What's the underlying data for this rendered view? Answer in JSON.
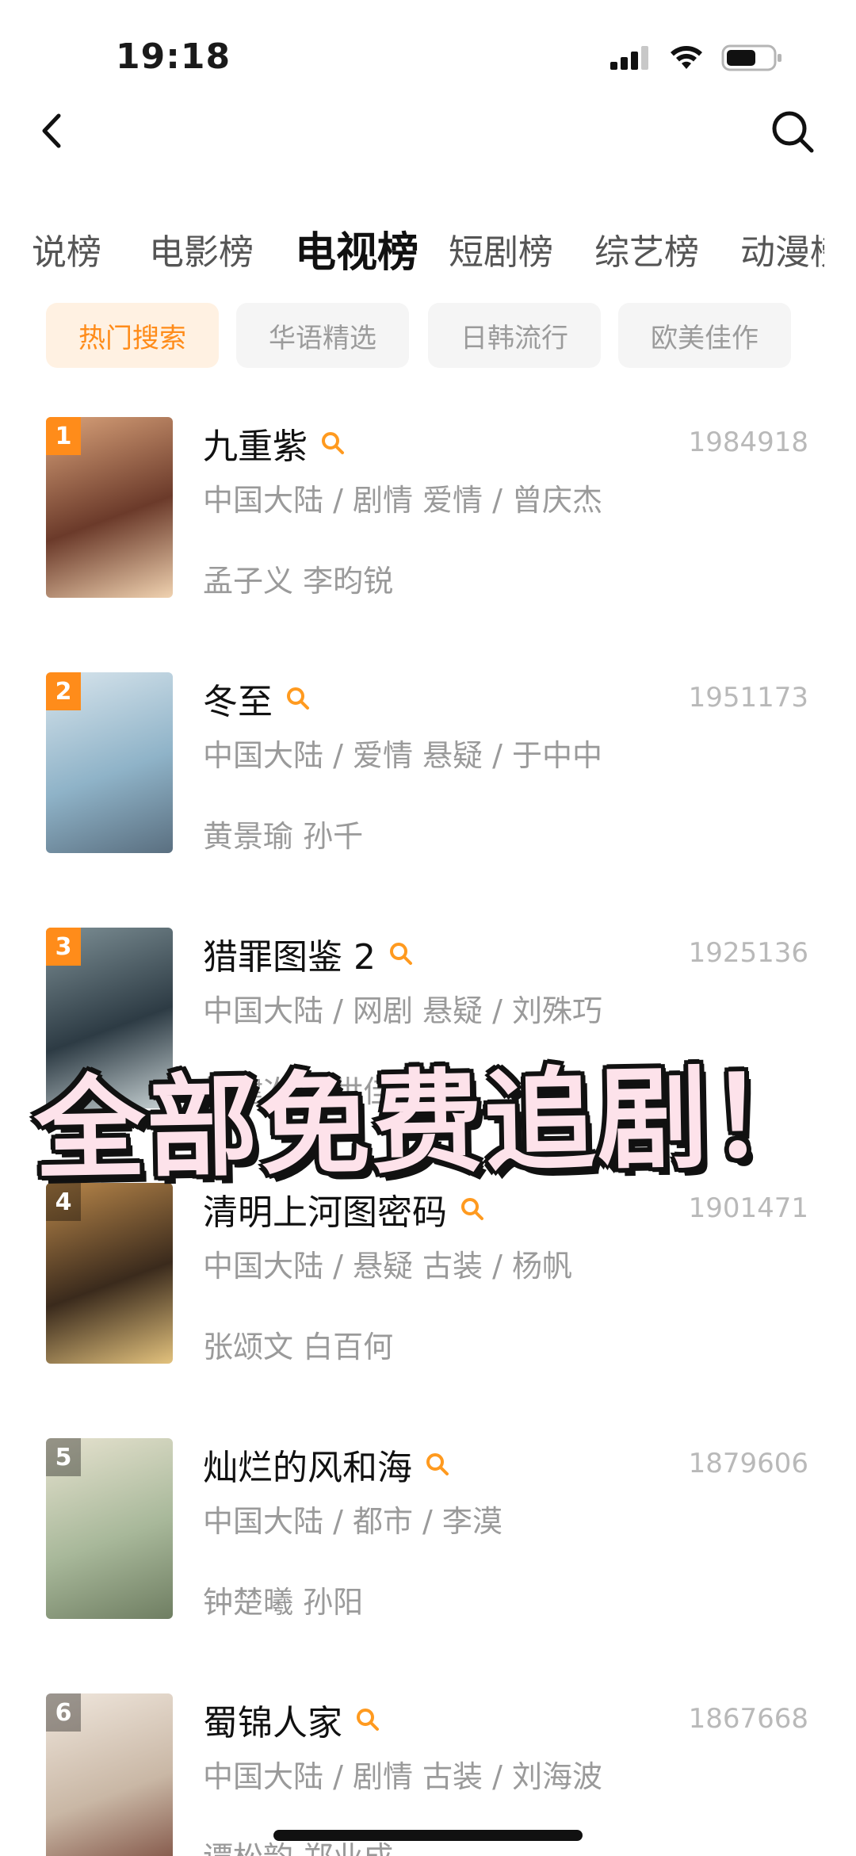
{
  "status_bar": {
    "time": "19:18"
  },
  "tabs": [
    {
      "label": "小说榜",
      "display": "说榜",
      "active": false
    },
    {
      "label": "电影榜",
      "active": false
    },
    {
      "label": "电视榜",
      "active": true
    },
    {
      "label": "短剧榜",
      "active": false
    },
    {
      "label": "综艺榜",
      "active": false
    },
    {
      "label": "动漫榜",
      "active": false
    }
  ],
  "chips": [
    {
      "label": "热门搜索",
      "active": true
    },
    {
      "label": "华语精选",
      "active": false
    },
    {
      "label": "日韩流行",
      "active": false
    },
    {
      "label": "欧美佳作",
      "active": false
    }
  ],
  "list": [
    {
      "rank": "1",
      "title": "九重紫",
      "heat": "1984918",
      "meta": "中国大陆 / 剧情 爱情 / 曾庆杰",
      "cast": "孟子义 李昀锐",
      "badge_color": "#ff8c1a",
      "poster_colors": [
        "#6b3a2a",
        "#d9a27a",
        "#f0d2b0"
      ]
    },
    {
      "rank": "2",
      "title": "冬至",
      "heat": "1951173",
      "meta": "中国大陆 / 爱情 悬疑 / 于中中",
      "cast": "黄景瑜 孙千",
      "badge_color": "#ff8c1a",
      "poster_colors": [
        "#8fb3c8",
        "#d7e4ec",
        "#5a6f80"
      ]
    },
    {
      "rank": "3",
      "title": "猎罪图鉴 2",
      "heat": "1925136",
      "meta": "中国大陆 / 网剧 悬疑 / 刘殊巧",
      "cast": "檀健次 金世佳",
      "badge_color": "#ff8c1a",
      "poster_colors": [
        "#2d3b44",
        "#7d8f95",
        "#c8d2d4"
      ]
    },
    {
      "rank": "4",
      "title": "清明上河图密码",
      "heat": "1901471",
      "meta": "中国大陆 / 悬疑 古装 / 杨帆",
      "cast": "张颂文 白百何",
      "badge_color": "rgba(0,0,0,0.35)",
      "poster_colors": [
        "#3a2a1c",
        "#b9874a",
        "#e3c27d"
      ]
    },
    {
      "rank": "5",
      "title": "灿烂的风和海",
      "heat": "1879606",
      "meta": "中国大陆 / 都市 / 李漠",
      "cast": "钟楚曦 孙阳",
      "badge_color": "rgba(0,0,0,0.35)",
      "poster_colors": [
        "#a8b89a",
        "#e6e2cf",
        "#6f7e62"
      ]
    },
    {
      "rank": "6",
      "title": "蜀锦人家",
      "heat": "1867668",
      "meta": "中国大陆 / 剧情 古装 / 刘海波",
      "cast": "谭松韵 郑业成",
      "badge_color": "rgba(0,0,0,0.35)",
      "poster_colors": [
        "#c9b7a5",
        "#efe6dc",
        "#7a4a3c"
      ]
    }
  ],
  "overlay": {
    "text": "全部免费追剧！"
  },
  "colors": {
    "accent": "#ff8c1a",
    "chip_active_bg": "#fff1e2"
  }
}
